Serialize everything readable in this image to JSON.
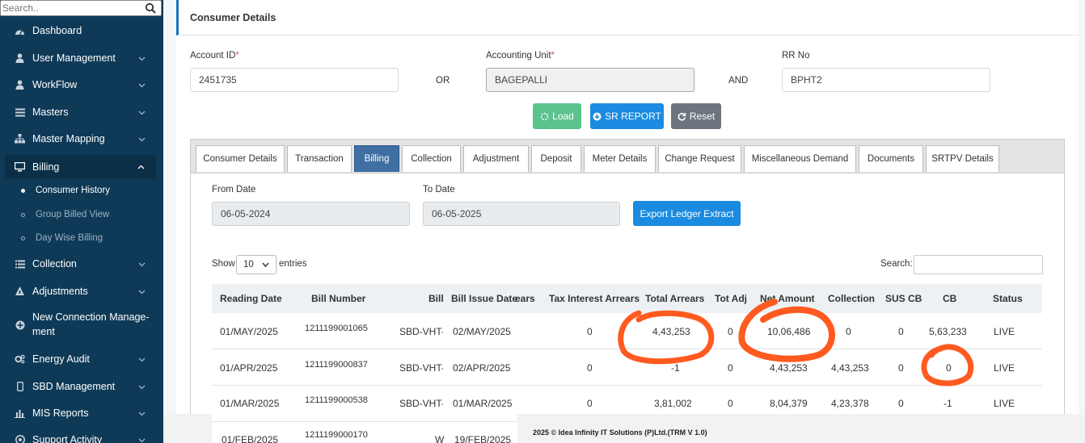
{
  "sidebar": {
    "search_placeholder": "Search..",
    "items": [
      {
        "label": "Dashboard"
      },
      {
        "label": "User Management"
      },
      {
        "label": "WorkFlow"
      },
      {
        "label": "Masters"
      },
      {
        "label": "Master Mapping"
      },
      {
        "label": "Billing"
      },
      {
        "label": "Collection"
      },
      {
        "label": "Adjustments"
      },
      {
        "label": "New Connection Manage-",
        "label2": "ment"
      },
      {
        "label": "Energy Audit"
      },
      {
        "label": "SBD Management"
      },
      {
        "label": "MIS Reports"
      },
      {
        "label": "Support Activity"
      }
    ],
    "billing_sub": [
      {
        "label": "Consumer History"
      },
      {
        "label": "Group Billed View"
      },
      {
        "label": "Day Wise Billing"
      }
    ]
  },
  "card": {
    "title": "Consumer Details",
    "account_id_label": "Account ID",
    "account_id_value": "2451735",
    "or": "OR",
    "accounting_unit_label": "Accounting Unit",
    "accounting_unit_value": "BAGEPALLI",
    "and": "AND",
    "rr_label": "RR No",
    "rr_value": "BPHT2",
    "required_mark": "*",
    "btn_load": "Load",
    "btn_sr": "SR REPORT",
    "btn_reset": "Reset"
  },
  "tabs": [
    "Consumer Details",
    "Transaction",
    "Billing",
    "Collection",
    "Adjustment",
    "Deposit",
    "Meter Details",
    "Change Request",
    "Miscellaneous Demand",
    "Documents",
    "SRTPV Details"
  ],
  "billing": {
    "from_label": "From Date",
    "from_value": "06-05-2024",
    "to_label": "To Date",
    "to_value": "06-05-2025",
    "export_btn": "Export Ledger Extract",
    "show_label": "Show",
    "show_value": "10",
    "entries_label": "entries",
    "search_label": "Search:"
  },
  "table": {
    "headers": [
      "Reading Date",
      "Bill Number",
      "Bill",
      "Bill Issue Date",
      "ears",
      "Tax Interest Arrears",
      "Total Arrears",
      "Tot Adj",
      "Net Amount",
      "Collection",
      "SUS CB",
      "CB",
      "Status"
    ],
    "rows": [
      [
        "01/MAY/2025",
        "1211199001065",
        "SBD-VHT-(",
        "02/MAY/2025",
        "0",
        "4,43,253",
        "0",
        "10,06,486",
        "0",
        "0",
        "5,63,233",
        "LIVE"
      ],
      [
        "01/APR/2025",
        "1211199000837",
        "SBD-VHT-(",
        "02/APR/2025",
        "0",
        "-1",
        "0",
        "4,43,253",
        "4,43,253",
        "0",
        "0",
        "LIVE"
      ],
      [
        "01/MAR/2025",
        "1211199000538",
        "SBD-VHT-(",
        "01/MAR/2025",
        "0",
        "3,81,002",
        "0",
        "8,04,379",
        "4,23,378",
        "0",
        "-1",
        "LIVE"
      ],
      [
        "01/FEB/2025",
        "1211199000170",
        "W",
        "19/FEB/2025",
        "",
        "",
        "",
        "",
        "",
        "",
        "",
        ""
      ]
    ]
  },
  "footer": {
    "text": "2025 © Idea Infinity IT Solutions (P)Ltd.(TRM V 1.0)"
  },
  "colors": {
    "sidebar_bg": "#0e3a57",
    "accent": "#1a8be0",
    "annotation": "#ff5a1f"
  }
}
